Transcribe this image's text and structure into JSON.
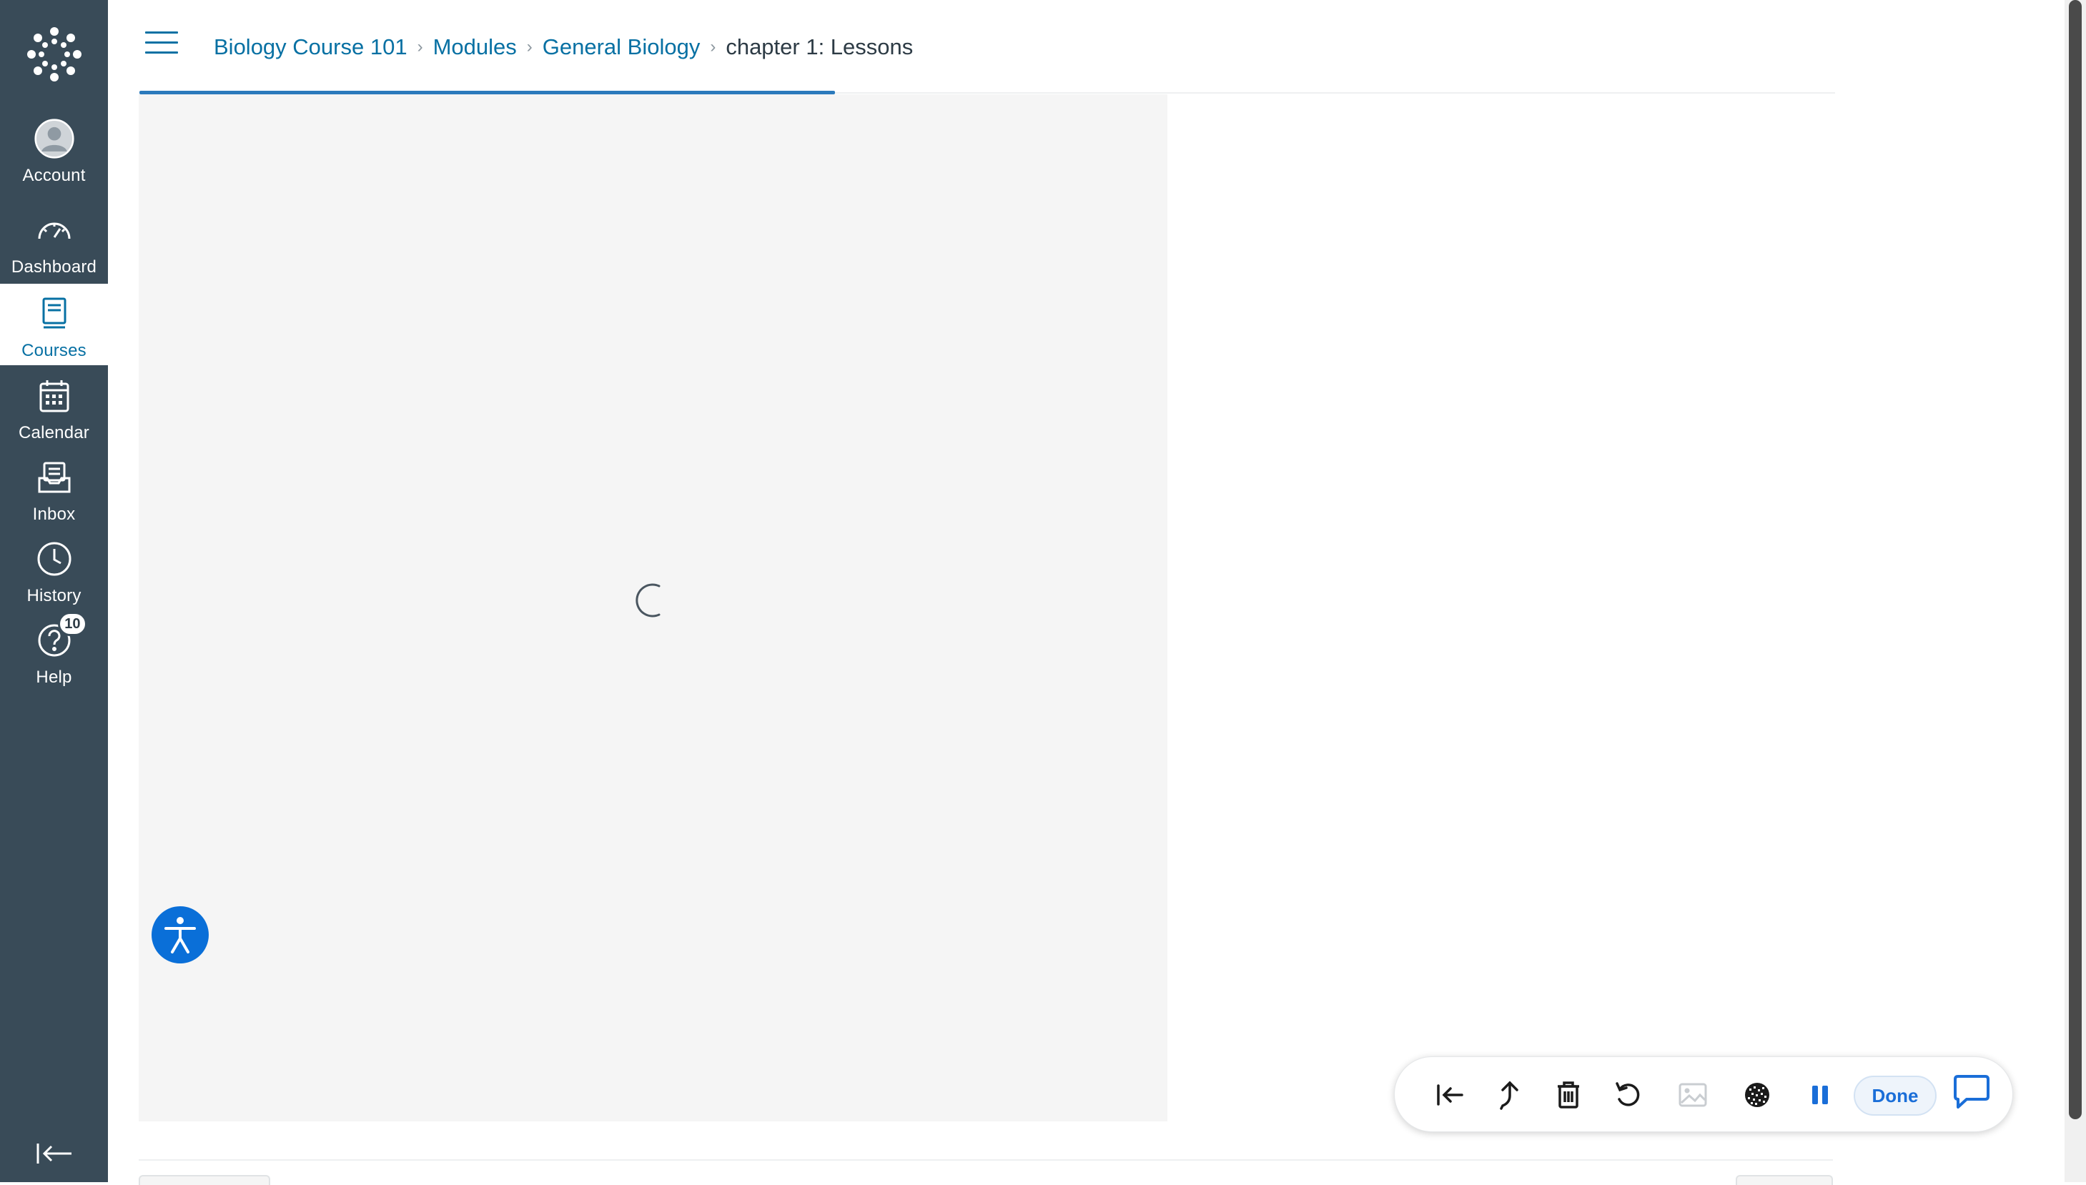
{
  "nav": {
    "items": [
      {
        "key": "account",
        "label": "Account",
        "icon": "avatar-icon"
      },
      {
        "key": "dashboard",
        "label": "Dashboard",
        "icon": "dashboard-icon"
      },
      {
        "key": "courses",
        "label": "Courses",
        "icon": "courses-icon",
        "active": true
      },
      {
        "key": "calendar",
        "label": "Calendar",
        "icon": "calendar-icon"
      },
      {
        "key": "inbox",
        "label": "Inbox",
        "icon": "inbox-icon"
      },
      {
        "key": "history",
        "label": "History",
        "icon": "clock-icon"
      },
      {
        "key": "help",
        "label": "Help",
        "icon": "help-icon",
        "badge": "10"
      }
    ]
  },
  "breadcrumb": {
    "items": [
      "Biology Course 101",
      "Modules",
      "General Biology"
    ],
    "current": "chapter 1: Lessons"
  },
  "toolbar": {
    "done_label": "Done",
    "icons": [
      "rewind-start-icon",
      "undo-arrow-icon",
      "trash-icon",
      "rotate-icon",
      "image-icon",
      "noise-icon",
      "pause-icon",
      "chat-icon"
    ]
  },
  "colors": {
    "nav_bg": "#394b58",
    "link": "#0770a3",
    "accent": "#2b7abc",
    "a11y": "#0a6fd8"
  }
}
